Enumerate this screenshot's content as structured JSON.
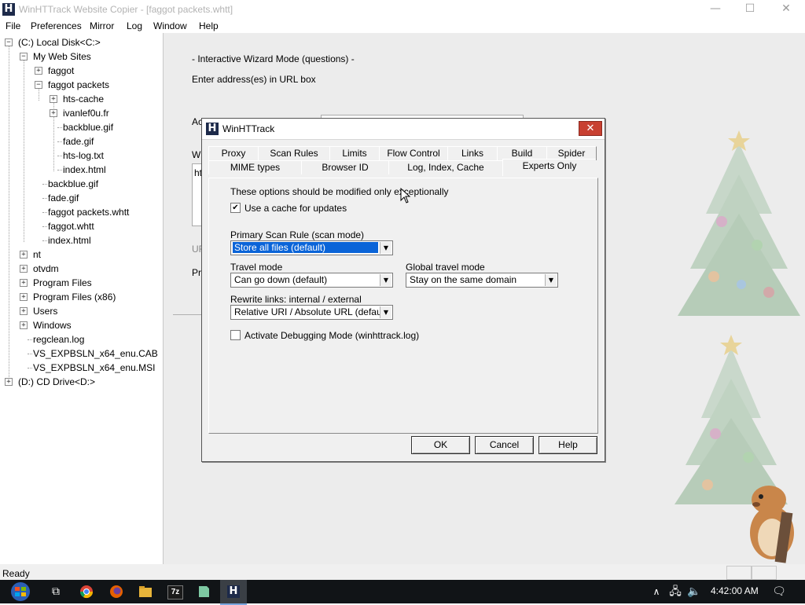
{
  "window": {
    "title": "WinHTTrack Website Copier - [faggot packets.whtt]",
    "minimize": "—",
    "maximize": "☐",
    "close": "✕"
  },
  "menubar": [
    "File",
    "Preferences",
    "Mirror",
    "Log",
    "Window",
    "Help"
  ],
  "tree": [
    {
      "label": "(C:) Local Disk<C:>",
      "exp": "-"
    },
    {
      "label": "My Web Sites",
      "exp": "-"
    },
    {
      "label": "faggot",
      "exp": "+"
    },
    {
      "label": "faggot packets",
      "exp": "-"
    },
    {
      "label": "hts-cache",
      "exp": "+"
    },
    {
      "label": "ivanlef0u.fr",
      "exp": "+"
    },
    {
      "label": "backblue.gif",
      "exp": ""
    },
    {
      "label": "fade.gif",
      "exp": ""
    },
    {
      "label": "hts-log.txt",
      "exp": ""
    },
    {
      "label": "index.html",
      "exp": ""
    },
    {
      "label": "backblue.gif",
      "exp": ""
    },
    {
      "label": "fade.gif",
      "exp": ""
    },
    {
      "label": "faggot packets.whtt",
      "exp": ""
    },
    {
      "label": "faggot.whtt",
      "exp": ""
    },
    {
      "label": "index.html",
      "exp": ""
    },
    {
      "label": "nt",
      "exp": "+"
    },
    {
      "label": "otvdm",
      "exp": "+"
    },
    {
      "label": "Program Files",
      "exp": "+"
    },
    {
      "label": "Program Files (x86)",
      "exp": "+"
    },
    {
      "label": "Users",
      "exp": "+"
    },
    {
      "label": "Windows",
      "exp": "+"
    },
    {
      "label": "regclean.log",
      "exp": ""
    },
    {
      "label": "VS_EXPBSLN_x64_enu.CAB",
      "exp": ""
    },
    {
      "label": "VS_EXPBSLN_x64_enu.MSI",
      "exp": ""
    },
    {
      "label": "(D:) CD Drive<D:>",
      "exp": "+"
    }
  ],
  "background": {
    "wizard_mode": "- Interactive Wizard Mode (questions) -",
    "enter_address": "Enter address(es) in URL box",
    "frag_action": "Ac",
    "frag_web": "W",
    "frag_ht": "ht",
    "frag_url": "UR",
    "frag_pr": "Pr"
  },
  "dialog": {
    "title": "WinHTTrack",
    "close": "✕",
    "tabs_row1": [
      "Proxy",
      "Scan Rules",
      "Limits",
      "Flow Control",
      "Links",
      "Build",
      "Spider"
    ],
    "tabs_row2": [
      "MIME types",
      "Browser ID",
      "Log, Index, Cache",
      "Experts Only"
    ],
    "note": "These options should be modified only exceptionally",
    "use_cache": {
      "label": "Use a cache for updates",
      "checked": "✔"
    },
    "primary_scan": {
      "label": "Primary Scan Rule (scan mode)",
      "value": "Store all files (default)"
    },
    "travel_mode": {
      "label": "Travel mode",
      "value": "Can go down (default)"
    },
    "global_travel": {
      "label": "Global travel mode",
      "value": "Stay on the same domain"
    },
    "rewrite_links": {
      "label": "Rewrite links: internal / external",
      "value": "Relative URI / Absolute URL (default)"
    },
    "debug": {
      "label": "Activate Debugging Mode (winhttrack.log)",
      "checked": ""
    },
    "buttons": {
      "ok": "OK",
      "cancel": "Cancel",
      "help": "Help"
    }
  },
  "status": {
    "text": "Ready"
  },
  "taskbar": {
    "time": "4:42:00 AM",
    "zip_label": "7z"
  }
}
